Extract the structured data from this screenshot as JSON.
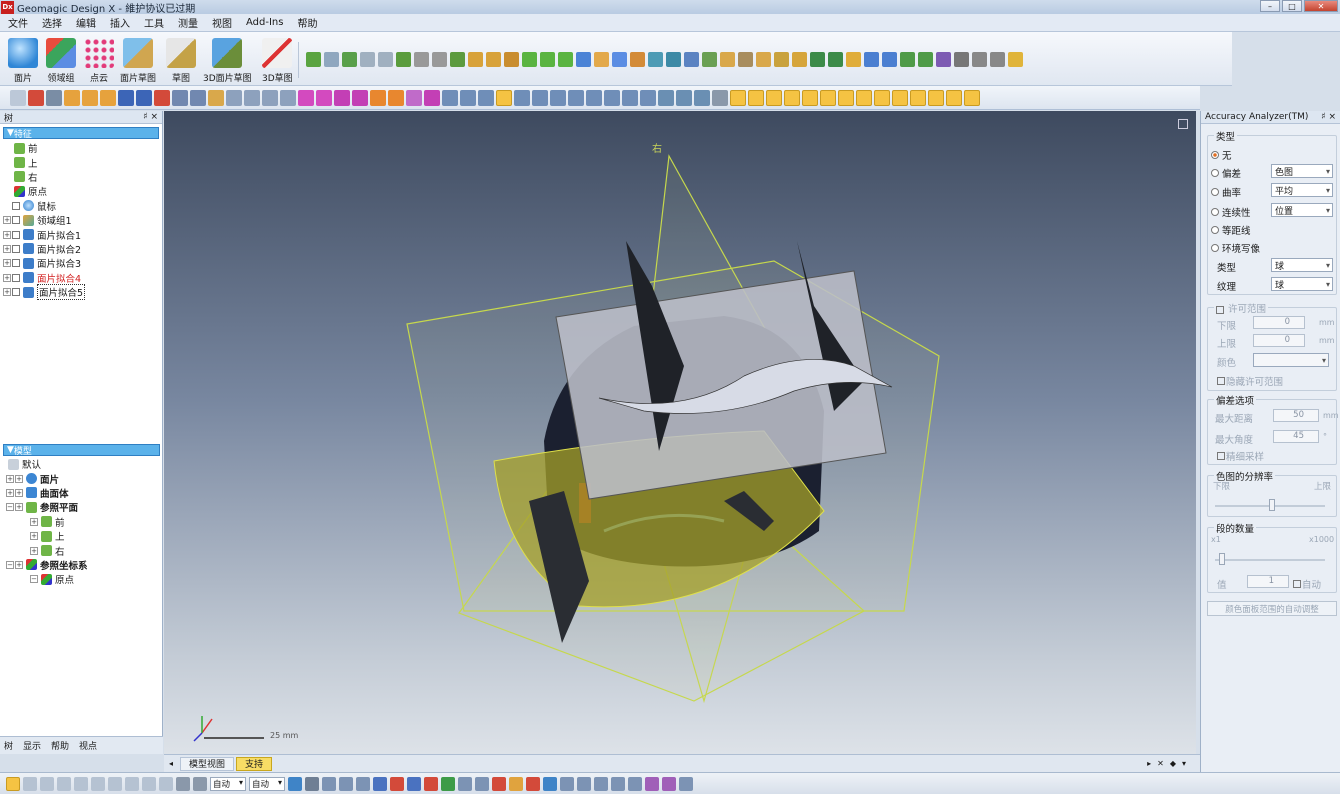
{
  "window": {
    "title": "Geomagic Design X - 維护协议已过期",
    "logo": "Dx"
  },
  "menu": [
    "文件",
    "选择",
    "编辑",
    "插入",
    "工具",
    "测量",
    "视图",
    "Add-Ins",
    "帮助"
  ],
  "ribbon": {
    "big_buttons": [
      "面片",
      "领域组",
      "点云",
      "面片草图",
      "草图",
      "3D面片草图",
      "3D草图"
    ]
  },
  "tree_panel": {
    "header": "树",
    "pin": "♯ ×",
    "feature_group": "特征",
    "features": [
      {
        "label": "前",
        "state": "plane"
      },
      {
        "label": "上",
        "state": "plane"
      },
      {
        "label": "右",
        "state": "plane"
      },
      {
        "label": "原点",
        "state": "axis"
      },
      {
        "label": "鼠标",
        "state": "mesh"
      },
      {
        "label": "领域组1",
        "state": "region"
      },
      {
        "label": "面片拟合1",
        "state": "fit"
      },
      {
        "label": "面片拟合2",
        "state": "fit"
      },
      {
        "label": "面片拟合3",
        "state": "fit"
      },
      {
        "label": "面片拟合4",
        "state": "fit-red"
      },
      {
        "label": "面片拟合5",
        "state": "fit-box"
      }
    ],
    "model_group": "模型",
    "model_items": [
      {
        "label": "默认",
        "level": 0,
        "bold": false
      },
      {
        "label": "面片",
        "level": 1,
        "bold": true
      },
      {
        "label": "曲面体",
        "level": 1,
        "bold": true
      },
      {
        "label": "参照平面",
        "level": 1,
        "bold": true
      },
      {
        "label": "前",
        "level": 2,
        "bold": false
      },
      {
        "label": "上",
        "level": 2,
        "bold": false
      },
      {
        "label": "右",
        "level": 2,
        "bold": false
      },
      {
        "label": "参照坐标系",
        "level": 1,
        "bold": true
      },
      {
        "label": "原点",
        "level": 2,
        "bold": false
      }
    ],
    "bottom_tabs": [
      "树",
      "显示",
      "帮助",
      "视点"
    ]
  },
  "viewport": {
    "plane_label": "右",
    "scale": "25 mm"
  },
  "view_tabs": {
    "tabs": [
      "模型视图",
      "支持"
    ],
    "active": "支持"
  },
  "accuracy_panel": {
    "title": "Accuracy Analyzer(TM)",
    "pin": "♯ ×",
    "type_label": "类型",
    "options": [
      {
        "label": "无",
        "selected": true
      },
      {
        "label": "偏差",
        "selected": false,
        "combo": "色图"
      },
      {
        "label": "曲率",
        "selected": false,
        "combo": "平均"
      },
      {
        "label": "连续性",
        "selected": false,
        "combo": "位置"
      },
      {
        "label": "等距线",
        "selected": false
      },
      {
        "label": "环境写像",
        "selected": false
      }
    ],
    "kind_label": "类型",
    "kind_value": "球",
    "texture_label": "纹理",
    "texture_value": "球",
    "allow_range": "许可范围",
    "lower_label": "下限",
    "lower_value": "0",
    "lower_unit": "mm",
    "upper_label": "上限",
    "upper_value": "0",
    "upper_unit": "mm",
    "color_label": "颜色",
    "hide_range": "隐藏许可范围",
    "deviation_options": "偏差选项",
    "max_distance_label": "最大距离",
    "max_distance_value": "50",
    "max_distance_unit": "mm",
    "max_angle_label": "最大角度",
    "max_angle_value": "45",
    "max_angle_unit": "°",
    "fine_sampling": "精细采样",
    "colormap_resolution": "色图的分辨率",
    "res_lower": "下限",
    "res_upper": "上限",
    "segment_count": "段的数量",
    "seg_min": "x1",
    "seg_max": "x1000",
    "value_label": "值",
    "value_value": "1",
    "auto_label": "自动",
    "auto_button": "颜色面板范围的自动调整"
  },
  "status_bar": {
    "combo1": "自动",
    "combo2": "自动"
  }
}
